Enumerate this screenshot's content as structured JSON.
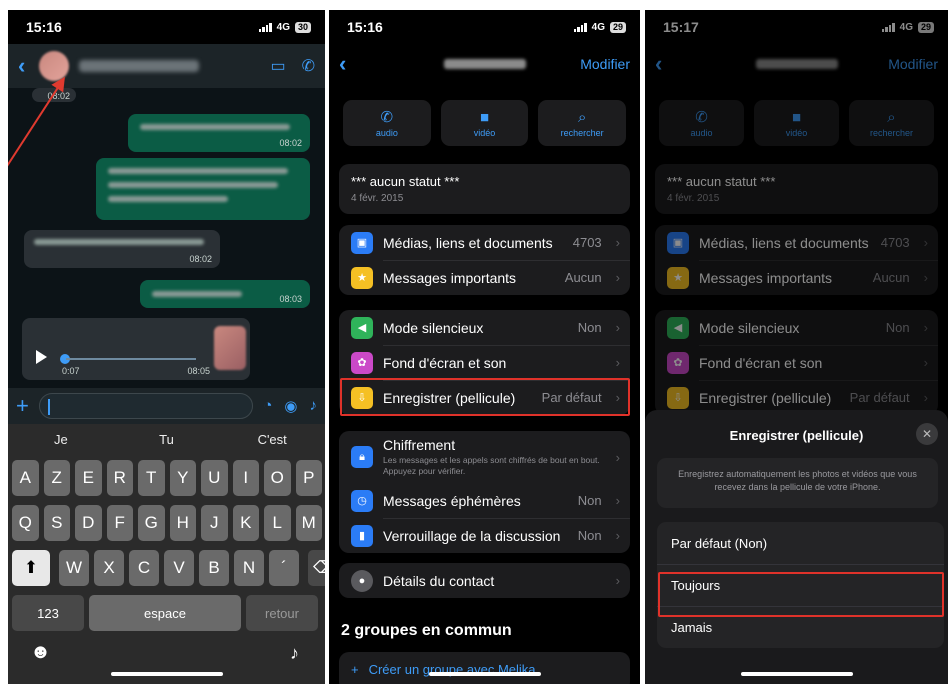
{
  "phone1": {
    "time": "15:16",
    "network": "4G",
    "battery": "30",
    "messages": [
      {
        "dir": "in",
        "time": "08:02"
      },
      {
        "dir": "out",
        "time": "08:02"
      },
      {
        "dir": "out",
        "time": ""
      },
      {
        "dir": "in",
        "time": "08:02"
      },
      {
        "dir": "out",
        "time": "08:03"
      }
    ],
    "voice": {
      "start": "0:07",
      "end": "08:05"
    },
    "suggestions": [
      "Je",
      "Tu",
      "C'est"
    ],
    "rows": [
      [
        "A",
        "Z",
        "E",
        "R",
        "T",
        "Y",
        "U",
        "I",
        "O",
        "P"
      ],
      [
        "Q",
        "S",
        "D",
        "F",
        "G",
        "H",
        "J",
        "K",
        "L",
        "M"
      ],
      [
        "W",
        "X",
        "C",
        "V",
        "B",
        "N",
        "´"
      ]
    ],
    "numbers_key": "123",
    "space_key": "espace",
    "return_key": "retour"
  },
  "phone2": {
    "time": "15:16",
    "network": "4G",
    "battery": "29",
    "edit": "Modifier",
    "actions": [
      "audio",
      "vidéo",
      "rechercher"
    ],
    "status_text": "*** aucun statut ***",
    "status_date": "4 févr. 2015",
    "group1": [
      {
        "label": "Médias, liens et documents",
        "value": "4703",
        "color": "#2b7cf6",
        "icon": "photo-icon"
      },
      {
        "label": "Messages importants",
        "value": "Aucun",
        "color": "#f5c024",
        "icon": "star-icon"
      }
    ],
    "group2": [
      {
        "label": "Mode silencieux",
        "value": "Non",
        "color": "#2fb35a",
        "icon": "speaker-icon"
      },
      {
        "label": "Fond d'écran et son",
        "value": "",
        "color": "#cb49c8",
        "icon": "flower-icon"
      },
      {
        "label": "Enregistrer (pellicule)",
        "value": "Par défaut",
        "color": "#f5c024",
        "icon": "save-icon"
      }
    ],
    "encryption_label": "Chiffrement",
    "encryption_desc": "Les messages et les appels sont chiffrés de bout en bout. Appuyez pour vérifier.",
    "group3": [
      {
        "label": "Messages éphémères",
        "value": "Non",
        "color": "#2b7cf6",
        "icon": "timer-icon"
      },
      {
        "label": "Verrouillage de la discussion",
        "value": "Non",
        "color": "#2b7cf6",
        "icon": "lock-icon"
      }
    ],
    "contact_details": "Détails du contact",
    "common_groups": "2 groupes en commun",
    "create_group": "Créer un groupe avec Melika"
  },
  "phone3": {
    "time": "15:17",
    "network": "4G",
    "battery": "29",
    "edit": "Modifier",
    "sheet_title": "Enregistrer (pellicule)",
    "sheet_desc": "Enregistrez automatiquement les photos et vidéos que vous recevez dans la pellicule de votre iPhone.",
    "options": [
      "Par défaut (Non)",
      "Toujours",
      "Jamais"
    ]
  }
}
